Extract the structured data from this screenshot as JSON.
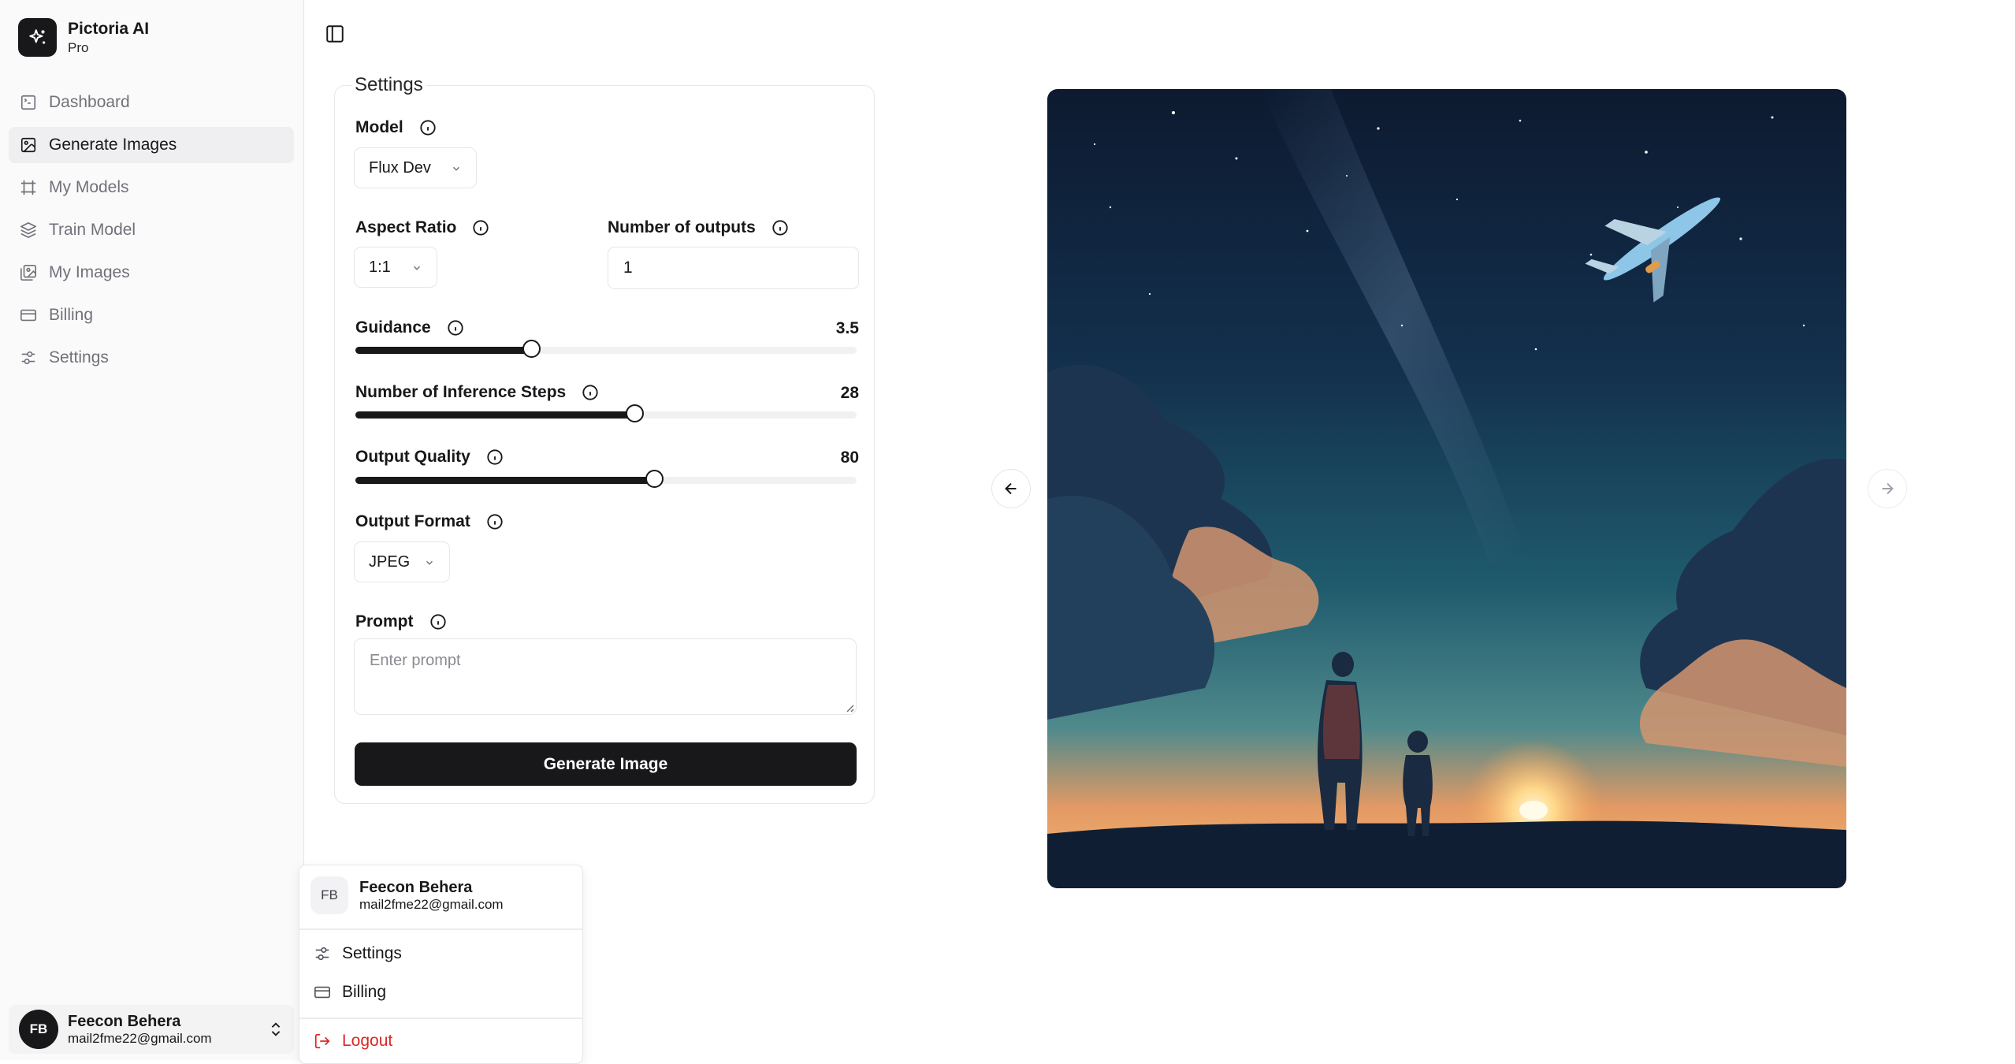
{
  "brand": {
    "name": "Pictoria AI",
    "plan": "Pro",
    "logo_icon": "sparkles-icon"
  },
  "sidebar": {
    "items": [
      {
        "label": "Dashboard",
        "icon": "square-terminal-icon",
        "active": false
      },
      {
        "label": "Generate Images",
        "icon": "image-icon",
        "active": true
      },
      {
        "label": "My Models",
        "icon": "frame-icon",
        "active": false
      },
      {
        "label": "Train Model",
        "icon": "layers-icon",
        "active": false
      },
      {
        "label": "My Images",
        "icon": "images-icon",
        "active": false
      },
      {
        "label": "Billing",
        "icon": "credit-card-icon",
        "active": false
      },
      {
        "label": "Settings",
        "icon": "sliders-icon",
        "active": false
      }
    ]
  },
  "user": {
    "initials": "FB",
    "name": "Feecon Behera",
    "email": "mail2fme22@gmail.com"
  },
  "settings": {
    "legend": "Settings",
    "model": {
      "label": "Model",
      "value": "Flux Dev"
    },
    "aspect_ratio": {
      "label": "Aspect Ratio",
      "value": "1:1"
    },
    "num_outputs": {
      "label": "Number of outputs",
      "value": "1"
    },
    "guidance": {
      "label": "Guidance",
      "value": "3.5",
      "fraction": 0.35
    },
    "inference_steps": {
      "label": "Number of Inference Steps",
      "value": "28",
      "fraction": 0.556
    },
    "output_quality": {
      "label": "Output Quality",
      "value": "80",
      "fraction": 0.596
    },
    "output_format": {
      "label": "Output Format",
      "value": "JPEG"
    },
    "prompt": {
      "label": "Prompt",
      "placeholder": "Enter prompt"
    },
    "generate_label": "Generate Image"
  },
  "user_menu": {
    "items": [
      {
        "label": "Settings",
        "icon": "sliders-icon"
      },
      {
        "label": "Billing",
        "icon": "credit-card-icon"
      }
    ],
    "logout_label": "Logout"
  },
  "colors": {
    "primary": "#18181b",
    "danger": "#dc2626",
    "border": "#e6e6e9",
    "sidebar_bg": "#fafafa"
  }
}
